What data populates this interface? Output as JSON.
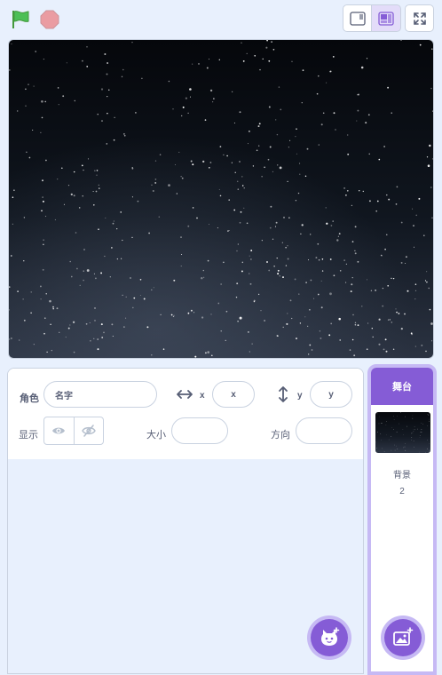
{
  "sprite_info": {
    "sprite_label": "角色",
    "name_placeholder": "名字",
    "x_label": "x",
    "x_placeholder": "x",
    "y_label": "y",
    "y_placeholder": "y",
    "show_label": "显示",
    "size_label": "大小",
    "direction_label": "方向"
  },
  "stage_panel": {
    "title": "舞台",
    "backdrops_label": "背景",
    "backdrops_count": "2"
  },
  "colors": {
    "accent": "#855cd6",
    "accent_light": "#c6b9f4",
    "flag_green": "#4cbf56",
    "stop_red": "#ec5959",
    "background": "#e8f0fd"
  }
}
